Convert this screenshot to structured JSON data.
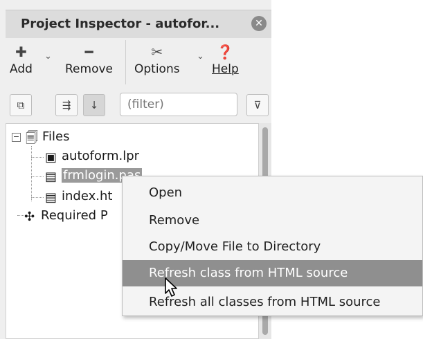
{
  "window": {
    "title": "Project Inspector - autofor...",
    "close_icon": "close-icon"
  },
  "toolbar": {
    "add_label": "Add",
    "remove_label": "Remove",
    "options_label": "Options",
    "help_label": "Help"
  },
  "filterbar": {
    "filter_placeholder": "(filter)"
  },
  "tree": {
    "files_label": "Files",
    "items": [
      {
        "label": "autoform.lpr"
      },
      {
        "label": "frmlogin.pas"
      },
      {
        "label": "index.ht"
      }
    ],
    "required_label": "Required P"
  },
  "context_menu": {
    "items": [
      {
        "label": "Open"
      },
      {
        "label": "Remove"
      },
      {
        "label": "Copy/Move File to Directory"
      },
      {
        "label": "Refresh class from HTML source"
      },
      {
        "label": "Refresh all classes from HTML source"
      }
    ],
    "highlighted_index": 3
  },
  "colors": {
    "selection": "#9a9a9a",
    "menu_highlight": "#8f8f8f"
  }
}
